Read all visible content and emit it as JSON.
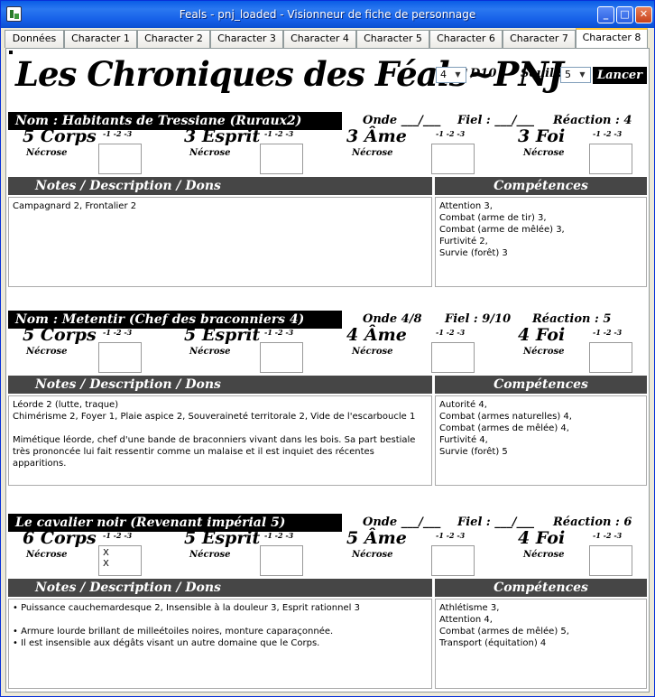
{
  "window": {
    "title": "Feals - pnj_loaded - Visionneur de fiche de personnage",
    "min_glyph": "_",
    "max_glyph": "□",
    "close_glyph": "✕"
  },
  "tabs": [
    {
      "label": "Données"
    },
    {
      "label": "Character 1"
    },
    {
      "label": "Character 2"
    },
    {
      "label": "Character 3"
    },
    {
      "label": "Character 4"
    },
    {
      "label": "Character 5"
    },
    {
      "label": "Character 6"
    },
    {
      "label": "Character 7"
    },
    {
      "label": "Character 8"
    }
  ],
  "header": {
    "title": "Les Chroniques des Féals~PNJ",
    "dice_value": "4",
    "d10_label": "D10 - ",
    "seuil_label": "Seuil :",
    "seuil_value": "5",
    "launch_label": "Lancer"
  },
  "labels": {
    "corps": "Corps",
    "esprit": "Esprit",
    "ame": "Âme",
    "foi": "Foi",
    "pips": "-1  -2  -3",
    "necrose": "Nécrose",
    "notes_header": "Notes   /   Description   /   Dons",
    "competences": "Compétences"
  },
  "characters": [
    {
      "name": "Nom : Habitants de Tressiane (Ruraux2)",
      "onde": "Onde ___/___",
      "fiel": "Fiel : ___/___",
      "reaction": "Réaction : 4",
      "corps": "5",
      "esprit": "3",
      "ame": "3",
      "foi": "3",
      "necrose_box1": "",
      "necrose_box2": "",
      "notes": [
        "Campagnard 2, Frontalier 2"
      ],
      "competences": [
        "Attention 3,",
        "Combat (arme de tir) 3,",
        "Combat (arme de mêlée) 3,",
        "Furtivité 2,",
        "Survie (forêt) 3"
      ]
    },
    {
      "name": "Nom : Metentir (Chef des braconniers 4)",
      "onde": "Onde 4/8",
      "fiel": "Fiel : 9/10",
      "reaction": "Réaction : 5",
      "corps": "5",
      "esprit": "5",
      "ame": "4",
      "foi": "4",
      "necrose_box1": "",
      "necrose_box2": "",
      "notes": [
        "Léorde 2 (lutte, traque)",
        "Chimérisme 2, Foyer 1, Plaie aspice 2, Souveraineté territorale 2, Vide de l'escarboucle 1",
        "",
        "Mimétique léorde, chef d'une bande de braconniers vivant dans les bois. Sa part bestiale très prononcée lui fait ressentir comme un malaise et il est inquiet des récentes apparitions."
      ],
      "competences": [
        "Autorité 4,",
        "Combat (armes naturelles) 4,",
        "Combat (armes de mêlée) 4,",
        "Furtivité 4,",
        "Survie (forêt) 5"
      ]
    },
    {
      "name": "Le cavalier noir (Revenant impérial 5)",
      "onde": "Onde ___/___",
      "fiel": "Fiel : ___/___",
      "reaction": "Réaction : 6",
      "corps": "6",
      "esprit": "5",
      "ame": "5",
      "foi": "4",
      "necrose_box1": "X\nX",
      "necrose_box2": "",
      "notes": [
        "• Puissance cauchemardesque 2, Insensible à la douleur 3, Esprit rationnel 3",
        "",
        "• Armure lourde brillant de milleétoiles noires, monture caparaçonnée.",
        "• Il est insensible aux dégâts visant un autre domaine que le Corps."
      ],
      "competences": [
        "Athlétisme 3,",
        "Attention 4,",
        "Combat (armes de mêlée) 5,",
        "Transport (équitation) 4"
      ]
    }
  ]
}
